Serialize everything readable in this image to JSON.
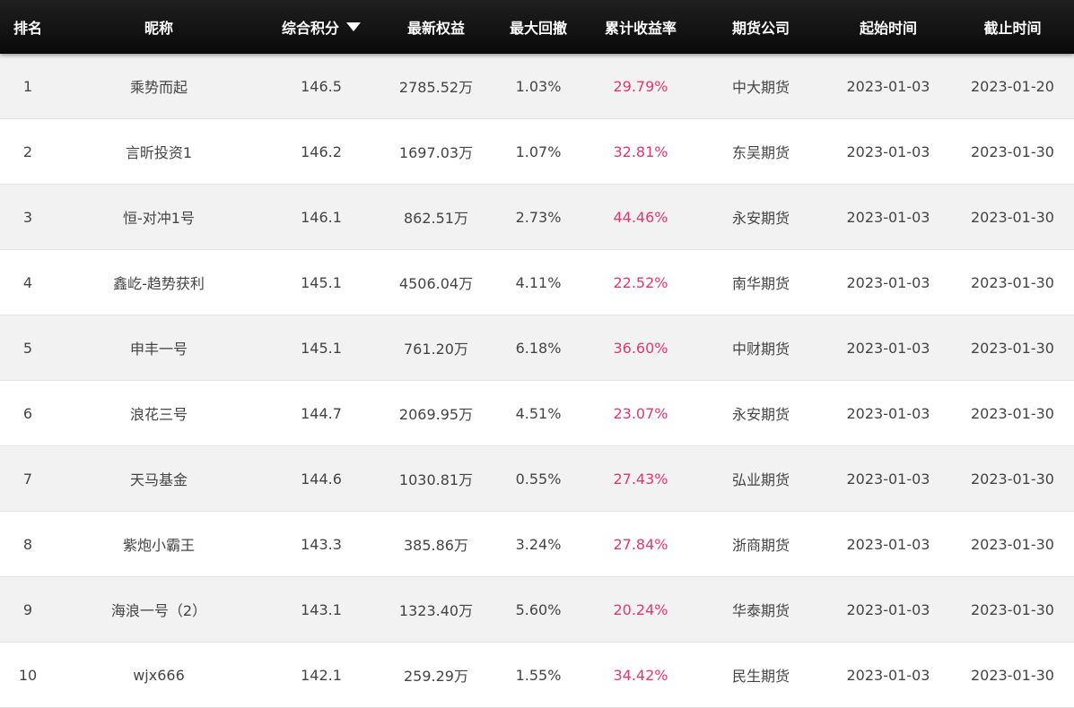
{
  "header": {
    "rank": "排名",
    "name": "昵称",
    "score": "综合积分",
    "equity": "最新权益",
    "drawdown": "最大回撤",
    "return": "累计收益率",
    "company": "期货公司",
    "start": "起始时间",
    "end": "截止时间"
  },
  "sort_icon": "caret-down-icon",
  "colors": {
    "header_bg": "#111111",
    "return_text": "#e8356d",
    "row_alt": "#f2f2f2"
  },
  "rows": [
    {
      "rank": "1",
      "name": "乘势而起",
      "score": "146.5",
      "equity": "2785.52万",
      "drawdown": "1.03%",
      "return": "29.79%",
      "company": "中大期货",
      "start": "2023-01-03",
      "end": "2023-01-20"
    },
    {
      "rank": "2",
      "name": "言昕投资1",
      "score": "146.2",
      "equity": "1697.03万",
      "drawdown": "1.07%",
      "return": "32.81%",
      "company": "东吴期货",
      "start": "2023-01-03",
      "end": "2023-01-30"
    },
    {
      "rank": "3",
      "name": "恒-对冲1号",
      "score": "146.1",
      "equity": "862.51万",
      "drawdown": "2.73%",
      "return": "44.46%",
      "company": "永安期货",
      "start": "2023-01-03",
      "end": "2023-01-30"
    },
    {
      "rank": "4",
      "name": "鑫屹-趋势获利",
      "score": "145.1",
      "equity": "4506.04万",
      "drawdown": "4.11%",
      "return": "22.52%",
      "company": "南华期货",
      "start": "2023-01-03",
      "end": "2023-01-30"
    },
    {
      "rank": "5",
      "name": "申丰一号",
      "score": "145.1",
      "equity": "761.20万",
      "drawdown": "6.18%",
      "return": "36.60%",
      "company": "中财期货",
      "start": "2023-01-03",
      "end": "2023-01-30"
    },
    {
      "rank": "6",
      "name": "浪花三号",
      "score": "144.7",
      "equity": "2069.95万",
      "drawdown": "4.51%",
      "return": "23.07%",
      "company": "永安期货",
      "start": "2023-01-03",
      "end": "2023-01-30"
    },
    {
      "rank": "7",
      "name": "天马基金",
      "score": "144.6",
      "equity": "1030.81万",
      "drawdown": "0.55%",
      "return": "27.43%",
      "company": "弘业期货",
      "start": "2023-01-03",
      "end": "2023-01-30"
    },
    {
      "rank": "8",
      "name": "紫炮小霸王",
      "score": "143.3",
      "equity": "385.86万",
      "drawdown": "3.24%",
      "return": "27.84%",
      "company": "浙商期货",
      "start": "2023-01-03",
      "end": "2023-01-30"
    },
    {
      "rank": "9",
      "name": "海浪一号（2）",
      "score": "143.1",
      "equity": "1323.40万",
      "drawdown": "5.60%",
      "return": "20.24%",
      "company": "华泰期货",
      "start": "2023-01-03",
      "end": "2023-01-30"
    },
    {
      "rank": "10",
      "name": "wjx666",
      "score": "142.1",
      "equity": "259.29万",
      "drawdown": "1.55%",
      "return": "34.42%",
      "company": "民生期货",
      "start": "2023-01-03",
      "end": "2023-01-30"
    }
  ]
}
